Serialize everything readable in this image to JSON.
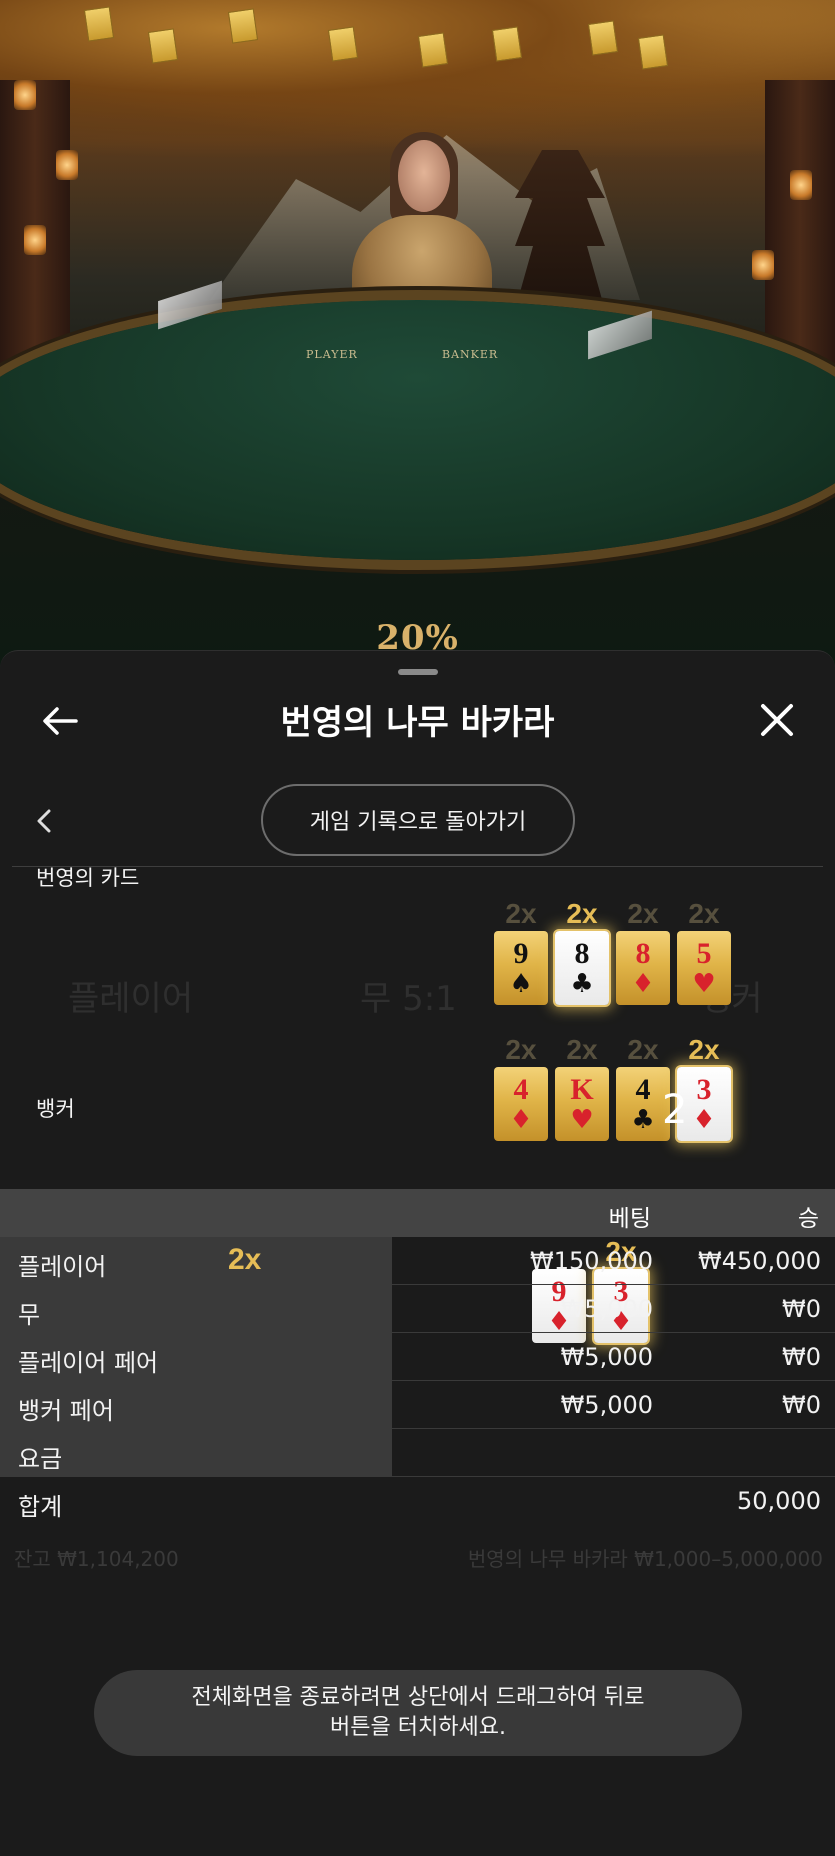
{
  "scene": {
    "promo_text": "20%",
    "table_labels": [
      "PLAYER",
      "BANKER"
    ]
  },
  "sheet": {
    "title": "번영의 나무 바카라",
    "back_to_history": "게임 기록으로 돌아가기",
    "icons": {
      "back": "arrow-left-icon",
      "close": "close-icon",
      "prev": "chevron-left-icon"
    }
  },
  "prosperity_cards": {
    "label": "번영의 카드",
    "rows": [
      [
        {
          "mult": "2x",
          "rank": "9",
          "suit": "♠",
          "color": "black",
          "face": "gold",
          "highlight": false
        },
        {
          "mult": "2x",
          "rank": "8",
          "suit": "♣",
          "color": "black",
          "face": "white",
          "highlight": true
        },
        {
          "mult": "2x",
          "rank": "8",
          "suit": "♦",
          "color": "red",
          "face": "gold",
          "highlight": false
        },
        {
          "mult": "2x",
          "rank": "5",
          "suit": "♥",
          "color": "red",
          "face": "gold",
          "highlight": false
        }
      ],
      [
        {
          "mult": "2x",
          "rank": "4",
          "suit": "♦",
          "color": "red",
          "face": "gold",
          "highlight": false
        },
        {
          "mult": "2x",
          "rank": "K",
          "suit": "♥",
          "color": "red",
          "face": "gold",
          "highlight": false
        },
        {
          "mult": "2x",
          "rank": "4",
          "suit": "♣",
          "color": "black",
          "face": "gold",
          "highlight": false
        },
        {
          "mult": "2x",
          "rank": "3",
          "suit": "♦",
          "color": "red",
          "face": "white",
          "highlight": true
        }
      ]
    ]
  },
  "banker_hand": {
    "label": "뱅커",
    "score": "2",
    "cards": [
      {
        "mult": "",
        "rank": "9",
        "suit": "♦",
        "color": "red",
        "face": "white",
        "highlight": false
      },
      {
        "mult": "2x",
        "rank": "3",
        "suit": "♦",
        "color": "red",
        "face": "white",
        "highlight": true
      }
    ]
  },
  "bets": {
    "header": {
      "bet": "베팅",
      "win": "승"
    },
    "rows": [
      {
        "label": "플레이어",
        "mult": "2x",
        "bet": "₩150,000",
        "win": "₩450,000"
      },
      {
        "label": "무",
        "mult": "",
        "bet": "₩5,000",
        "win": "₩0"
      },
      {
        "label": "플레이어 페어",
        "mult": "",
        "bet": "₩5,000",
        "win": "₩0"
      },
      {
        "label": "뱅커 페어",
        "mult": "",
        "bet": "₩5,000",
        "win": "₩0"
      },
      {
        "label": "요금",
        "mult": "",
        "bet": "",
        "win": ""
      }
    ],
    "total": {
      "label": "합계",
      "win": "50,000"
    }
  },
  "background_ghost": {
    "player": "플레이어",
    "tie": "무 5:1",
    "banker": "뱅커",
    "balance": "잔고 ₩1,104,200",
    "limits": "번영의 나무 바카라 ₩1,000–5,000,000"
  },
  "toast": {
    "line1": "전체화면을 종료하려면 상단에서 드래그하여 뒤로",
    "line2": "버튼을 터치하세요."
  }
}
